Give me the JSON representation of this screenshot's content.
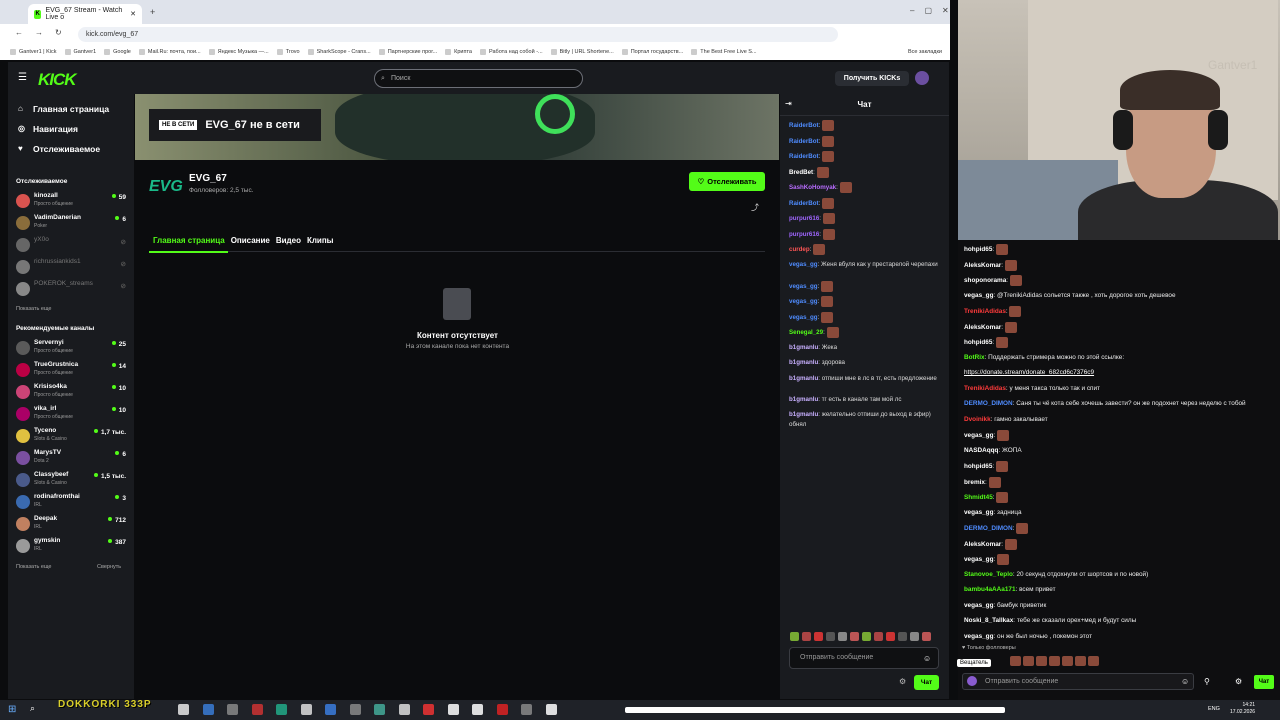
{
  "browser": {
    "tab_title": "EVG_67 Stream - Watch Live o",
    "url": "kick.com/evg_67",
    "bookmarks": [
      "Gantver1 | Kick",
      "Gantver1",
      "Google",
      "Mail.Ru: почта, пои...",
      "Яндекс Музыка —...",
      "Trovo",
      "SharkScope - Crans...",
      "Партнерские прог...",
      "Крипта",
      "Работа над собой -...",
      "Bitly | URL Shortene...",
      "Портал государств...",
      "The Best Free Live S..."
    ],
    "bookmarks_more": "Все закладки"
  },
  "kick": {
    "logo": "KICK",
    "search_placeholder": "Поиск",
    "get_kicks": "Получить KICKs",
    "nav": [
      "Главная страница",
      "Навигация",
      "Отслеживаемое"
    ],
    "followed_title": "Отслеживаемое",
    "followed": [
      {
        "name": "kinozall",
        "sub": "Просто общение",
        "count": "59",
        "online": true
      },
      {
        "name": "VadimDanerian",
        "sub": "Poker",
        "count": "6",
        "online": true
      },
      {
        "name": "yX0o",
        "sub": "",
        "count": "",
        "online": false
      },
      {
        "name": "richrussiankids1",
        "sub": "",
        "count": "",
        "online": false
      },
      {
        "name": "POKEROK_streams",
        "sub": "",
        "count": "",
        "online": false
      }
    ],
    "show_more": "Показать еще",
    "recommended_title": "Рекомендуемые каналы",
    "recommended": [
      {
        "name": "Servernyi",
        "sub": "Просто общение",
        "count": "25"
      },
      {
        "name": "TrueGrustnica",
        "sub": "Просто общение",
        "count": "14"
      },
      {
        "name": "Krisiso4ka",
        "sub": "Просто общение",
        "count": "10"
      },
      {
        "name": "vika_irl",
        "sub": "Просто общение",
        "count": "10"
      },
      {
        "name": "Tyceno",
        "sub": "Slots & Casino",
        "count": "1,7 тыс."
      },
      {
        "name": "MarysTV",
        "sub": "Dota 2",
        "count": "6"
      },
      {
        "name": "Classybeef",
        "sub": "Slots & Casino",
        "count": "1,5 тыс."
      },
      {
        "name": "rodinafromthai",
        "sub": "IRL",
        "count": "3"
      },
      {
        "name": "Deepak",
        "sub": "IRL",
        "count": "712"
      },
      {
        "name": "gymskin",
        "sub": "IRL",
        "count": "387"
      }
    ],
    "show_more2": "Показать еще",
    "collapse": "Свернуть",
    "offline_badge": "НЕ В СЕТИ",
    "offline_title": "EVG_67 не в сети",
    "channel_logo": "EVG",
    "channel_name": "EVG_67",
    "followers": "Фолловеров: 2,5 тыс.",
    "follow_btn": "Отслеживать",
    "tabs": [
      "Главная страница",
      "Описание",
      "Видео",
      "Клипы"
    ],
    "empty_title": "Контент отсутствует",
    "empty_sub": "На этом канале пока нет контента",
    "chat_title": "Чат",
    "chat": [
      {
        "user": "RaiderBot",
        "color": "#4f8cff",
        "text": ""
      },
      {
        "user": "RaiderBot",
        "color": "#4f8cff",
        "text": ""
      },
      {
        "user": "RaiderBot",
        "color": "#4f8cff",
        "text": ""
      },
      {
        "user": "BredBet",
        "color": "#ffffff",
        "text": ""
      },
      {
        "user": "SashKoHomyak",
        "color": "#b86cff",
        "text": ""
      },
      {
        "user": "RaiderBot",
        "color": "#4f8cff",
        "text": ""
      },
      {
        "user": "purpur616",
        "color": "#a066ff",
        "text": ""
      },
      {
        "user": "purpur616",
        "color": "#a066ff",
        "text": ""
      },
      {
        "user": "curdep",
        "color": "#ff5555",
        "text": ""
      },
      {
        "user": "vegas_gg",
        "color": "#4f8cff",
        "text": "Женя вбуля как у престарелой черепахи"
      },
      {
        "user": "vegas_gg",
        "color": "#4f8cff",
        "text": ""
      },
      {
        "user": "vegas_gg",
        "color": "#4f8cff",
        "text": ""
      },
      {
        "user": "vegas_gg",
        "color": "#4f8cff",
        "text": ""
      },
      {
        "user": "Senegal_29",
        "color": "#53fc18",
        "text": ""
      },
      {
        "user": "b1gmanlu",
        "color": "#c8b0ff",
        "text": "Жека"
      },
      {
        "user": "b1gmanlu",
        "color": "#c8b0ff",
        "text": "здорова"
      },
      {
        "user": "b1gmanlu",
        "color": "#c8b0ff",
        "text": "отпиши мне в лс в тг, есть предложение"
      },
      {
        "user": "b1gmanlu",
        "color": "#c8b0ff",
        "text": "тг есть в канале там мой лс"
      },
      {
        "user": "b1gmanlu",
        "color": "#c8b0ff",
        "text": "желательно отпиши до выход в эфир) обнял"
      }
    ],
    "chat_placeholder": "Отправить сообщение",
    "chat_btn": "Чат"
  },
  "webcam": {
    "watermark": "Gantver1"
  },
  "overlay_chat": [
    {
      "user": "hohpid65",
      "color": "#ffffff",
      "text": ""
    },
    {
      "user": "AleksKomar",
      "color": "#ffffff",
      "text": ""
    },
    {
      "user": "shoponorama",
      "color": "#ffffff",
      "text": ""
    },
    {
      "user": "vegas_gg",
      "color": "#ffffff",
      "text": "@TrenikiAdidas сольется также , хоть дорогое хоть дешевое"
    },
    {
      "user": "TrenikiAdidas",
      "color": "#ff3b3b",
      "text": ""
    },
    {
      "user": "AleksKomar",
      "color": "#ffffff",
      "text": ""
    },
    {
      "user": "hohpid65",
      "color": "#ffffff",
      "text": ""
    },
    {
      "user": "BotRix",
      "color": "#53fc18",
      "text": "Поддержать стримера можно по этой ссылке:"
    },
    {
      "user": "",
      "color": "#ffffff",
      "text": "https://donate.stream/donate_682cd6c7376c9"
    },
    {
      "user": "TrenikiAdidas",
      "color": "#ff3b3b",
      "text": "у меня такса только так и спит"
    },
    {
      "user": "DERMO_DIMON",
      "color": "#4f8cff",
      "text": "Саня ты чё кота себе хочешь завести? он же подохнет через неделю с тобой"
    },
    {
      "user": "Dvoinikk",
      "color": "#ff3b3b",
      "text": "гамно закалывает"
    },
    {
      "user": "vegas_gg",
      "color": "#ffffff",
      "text": ""
    },
    {
      "user": "NASDAqqq",
      "color": "#ffffff",
      "text": "ЖОПА"
    },
    {
      "user": "hohpid65",
      "color": "#ffffff",
      "text": ""
    },
    {
      "user": "bremix",
      "color": "#ffffff",
      "text": ""
    },
    {
      "user": "Shmidt45",
      "color": "#53fc18",
      "text": ""
    },
    {
      "user": "vegas_gg",
      "color": "#ffffff",
      "text": "задница"
    },
    {
      "user": "DERMO_DIMON",
      "color": "#4f8cff",
      "text": ""
    },
    {
      "user": "AleksKomar",
      "color": "#ffffff",
      "text": ""
    },
    {
      "user": "vegas_gg",
      "color": "#ffffff",
      "text": ""
    },
    {
      "user": "Stanovoe_Teplo",
      "color": "#53fc18",
      "text": "20 секунд отдохнули от шортсов и по новой)"
    },
    {
      "user": "bambu4aAAa171",
      "color": "#53fc18",
      "text": "всем привет"
    },
    {
      "user": "vegas_gg",
      "color": "#ffffff",
      "text": "бамбук приветик"
    },
    {
      "user": "Noski_8_Tallkax",
      "color": "#ffffff",
      "text": "тебе же сказали орех+мед и будут силы"
    },
    {
      "user": "vegas_gg",
      "color": "#ffffff",
      "text": "он же был ночью , покемон этот"
    }
  ],
  "overlay": {
    "only_followers": "Только фолловеры",
    "broadcaster": "Вещатель",
    "placeholder": "Отправить сообщение",
    "chat_btn": "Чат"
  },
  "taskbar": {
    "overlay_text": "DOKKORKI 333P",
    "lang": "ENG",
    "time": "14:21",
    "date": "17.02.2026"
  }
}
